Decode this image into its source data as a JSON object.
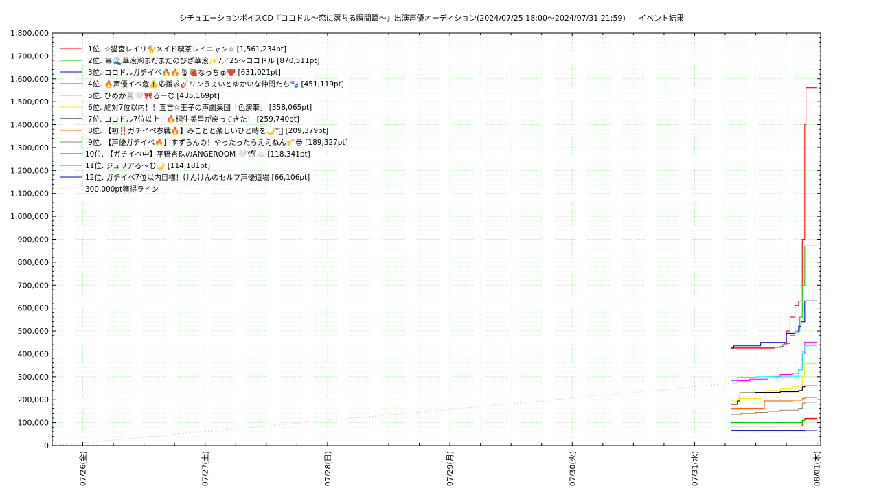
{
  "chart_data": {
    "type": "line",
    "title": "シチュエーションボイスCD『ココドル〜恋に落ちる瞬間篇〜』出演声優オーディション(2024/07/25 18:00〜2024/07/31 21:59)",
    "subtitle": "イベント結果",
    "xlabel": "",
    "ylabel": "",
    "x_tick_labels": [
      "07/26(金)",
      "07/27(土)",
      "07/28(日)",
      "07/29(月)",
      "07/30(火)",
      "07/31(水)",
      "08/01(木)"
    ],
    "xlim": [
      -0.25,
      6.03
    ],
    "ylim": [
      0,
      1800000
    ],
    "y_tick_values": [
      0,
      100000,
      200000,
      300000,
      400000,
      500000,
      600000,
      700000,
      800000,
      900000,
      1000000,
      1100000,
      1200000,
      1300000,
      1400000,
      1500000,
      1600000,
      1700000,
      1800000
    ],
    "y_tick_labels": [
      "0",
      "100,000",
      "200,000",
      "300,000",
      "400,000",
      "500,000",
      "600,000",
      "700,000",
      "800,000",
      "900,000",
      "1,000,000",
      "1,100,000",
      "1,200,000",
      "1,300,000",
      "1,400,000",
      "1,500,000",
      "1,600,000",
      "1,700,000",
      "1,800,000"
    ],
    "grid": true,
    "legend_position": "top-left",
    "series": [
      {
        "name": "1位. ☆猫宮レイリ🐈メイド喫茶レイニャン☆ [1,561,234pt]",
        "color": "#ff0000",
        "points": [
          [
            5.3,
            425000
          ],
          [
            5.65,
            430000
          ],
          [
            5.72,
            440000
          ],
          [
            5.75,
            500000
          ],
          [
            5.78,
            560000
          ],
          [
            5.81,
            560000
          ],
          [
            5.82,
            610000
          ],
          [
            5.85,
            630000
          ],
          [
            5.87,
            660000
          ],
          [
            5.88,
            900000
          ],
          [
            5.9,
            1400000
          ],
          [
            5.91,
            1561234
          ],
          [
            6.0,
            1561234
          ]
        ]
      },
      {
        "name": "2位. 🦝🌊華滚㈱まだまだのびざ華滚✨7／25〜ココドル [870,511pt]",
        "color": "#00cc00",
        "points": [
          [
            5.3,
            428000
          ],
          [
            5.7,
            432000
          ],
          [
            5.73,
            445000
          ],
          [
            5.78,
            480000
          ],
          [
            5.82,
            500000
          ],
          [
            5.86,
            560000
          ],
          [
            5.88,
            700000
          ],
          [
            5.9,
            870511
          ],
          [
            6.0,
            870511
          ]
        ]
      },
      {
        "name": "3位. ココドルガチイベ🔥🔥🎙🍓なっちゅ❤️ [631,021pt]",
        "color": "#0000cc",
        "points": [
          [
            5.3,
            425000
          ],
          [
            5.32,
            435000
          ],
          [
            5.52,
            435000
          ],
          [
            5.54,
            450000
          ],
          [
            5.74,
            450000
          ],
          [
            5.75,
            490000
          ],
          [
            5.82,
            495000
          ],
          [
            5.85,
            520000
          ],
          [
            5.87,
            540000
          ],
          [
            5.9,
            631021
          ],
          [
            6.0,
            631021
          ]
        ]
      },
      {
        "name": "4位. 🔥声優イベ危⚠️応援求🎸リンうぇいとゆかいな仲間たち🐾 [451,119pt]",
        "color": "#ff00ff",
        "points": [
          [
            5.3,
            283000
          ],
          [
            5.4,
            283000
          ],
          [
            5.45,
            290000
          ],
          [
            5.6,
            300000
          ],
          [
            5.7,
            310000
          ],
          [
            5.8,
            315000
          ],
          [
            5.85,
            330000
          ],
          [
            5.88,
            400000
          ],
          [
            5.9,
            451119
          ],
          [
            6.0,
            451119
          ]
        ]
      },
      {
        "name": "5位. ひめか🐰🤍🎀るーむ [435,169pt]",
        "color": "#00ffff",
        "points": [
          [
            5.3,
            285000
          ],
          [
            5.35,
            298000
          ],
          [
            5.5,
            300000
          ],
          [
            5.65,
            302000
          ],
          [
            5.8,
            302000
          ],
          [
            5.85,
            330000
          ],
          [
            5.88,
            410000
          ],
          [
            5.9,
            435169
          ],
          [
            6.0,
            435169
          ]
        ]
      },
      {
        "name": "6位. 絶対7位以内！！直吉☆王子の声劇集団「色演筆」 [358,065pt]",
        "color": "#ffee00",
        "points": [
          [
            5.3,
            195000
          ],
          [
            5.35,
            205000
          ],
          [
            5.55,
            210000
          ],
          [
            5.58,
            240000
          ],
          [
            5.7,
            250000
          ],
          [
            5.8,
            255000
          ],
          [
            5.85,
            260000
          ],
          [
            5.88,
            300000
          ],
          [
            5.9,
            358065
          ],
          [
            6.0,
            358065
          ]
        ]
      },
      {
        "name": "7位. ココドル7位以上！🔥桐生美里が戻ってきた！ [259,740pt]",
        "color": "#000000",
        "points": [
          [
            5.3,
            180000
          ],
          [
            5.35,
            195000
          ],
          [
            5.37,
            230000
          ],
          [
            5.5,
            232000
          ],
          [
            5.7,
            235000
          ],
          [
            5.85,
            240000
          ],
          [
            5.88,
            255000
          ],
          [
            5.9,
            259740
          ],
          [
            6.0,
            259740
          ]
        ]
      },
      {
        "name": "8位. 【初‼️ガチイベ参戦🔥】みことと楽しいひと時を🌙*ﾟ [209,379pt]",
        "color": "#ff6600",
        "points": [
          [
            5.3,
            160000
          ],
          [
            5.55,
            160000
          ],
          [
            5.57,
            195000
          ],
          [
            5.8,
            198000
          ],
          [
            5.88,
            205000
          ],
          [
            5.9,
            209379
          ],
          [
            6.0,
            209379
          ]
        ]
      },
      {
        "name": "9位. 【声優ガチイベ🔥】すずらんの！やったったらええねん🎷😎 [189,327pt]",
        "color": "#888888",
        "points": [
          [
            5.3,
            135000
          ],
          [
            5.38,
            140000
          ],
          [
            5.5,
            145000
          ],
          [
            5.6,
            150000
          ],
          [
            5.7,
            155000
          ],
          [
            5.85,
            160000
          ],
          [
            5.88,
            185000
          ],
          [
            5.9,
            189327
          ],
          [
            6.0,
            189327
          ]
        ]
      },
      {
        "name": "10位. 【ガチイベ中】平野杏珠のANGEROOM 🤍🕊☁️ [118,341pt]",
        "color": "#ff0000",
        "points": [
          [
            5.3,
            85000
          ],
          [
            5.85,
            85000
          ],
          [
            5.88,
            110000
          ],
          [
            5.9,
            118341
          ],
          [
            6.0,
            118341
          ]
        ]
      },
      {
        "name": "11位. ジュリアる〜む🌙 [114,181pt]",
        "color": "#00cc00",
        "points": [
          [
            5.3,
            100000
          ],
          [
            5.85,
            100000
          ],
          [
            5.88,
            110000
          ],
          [
            5.9,
            114181
          ],
          [
            6.0,
            114181
          ]
        ]
      },
      {
        "name": "12位. ガチイベ7位以内目標！けんけんのセルフ声優道場 [66,106pt]",
        "color": "#0000cc",
        "points": [
          [
            5.3,
            65000
          ],
          [
            5.9,
            66106
          ],
          [
            6.0,
            66106
          ]
        ]
      },
      {
        "name": "300,000pt獲得ライン",
        "color": "#ff9999",
        "dashed": true,
        "points": [
          [
            -0.25,
            0
          ],
          [
            5.9,
            300000
          ],
          [
            6.03,
            300000
          ]
        ]
      }
    ]
  }
}
